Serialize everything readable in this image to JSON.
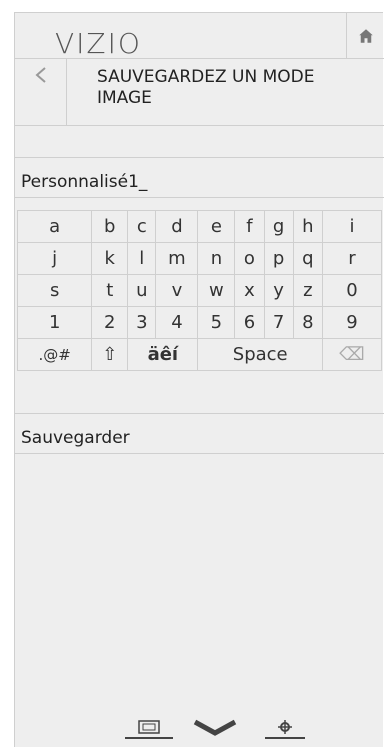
{
  "header": {
    "brand": "VIZIO"
  },
  "page": {
    "title": "SAUVEGARDEZ UN MODE IMAGE"
  },
  "input": {
    "value": "Personnalisé1_"
  },
  "keyboard": {
    "rows": [
      [
        "a",
        "b",
        "c",
        "d",
        "e",
        "f",
        "g",
        "h",
        "i"
      ],
      [
        "j",
        "k",
        "l",
        "m",
        "n",
        "o",
        "p",
        "q",
        "r"
      ],
      [
        "s",
        "t",
        "u",
        "v",
        "w",
        "x",
        "y",
        "z",
        "0"
      ],
      [
        "1",
        "2",
        "3",
        "4",
        "5",
        "6",
        "7",
        "8",
        "9"
      ]
    ],
    "special": {
      "symbols": ".@#",
      "shift": "⇧",
      "accents": "äêí",
      "space": "Space",
      "backspace": "⌫"
    }
  },
  "actions": {
    "save": "Sauvegarder"
  },
  "colors": {
    "background": "#eeeeee",
    "divider": "#cfcfcf",
    "text": "#222222"
  }
}
